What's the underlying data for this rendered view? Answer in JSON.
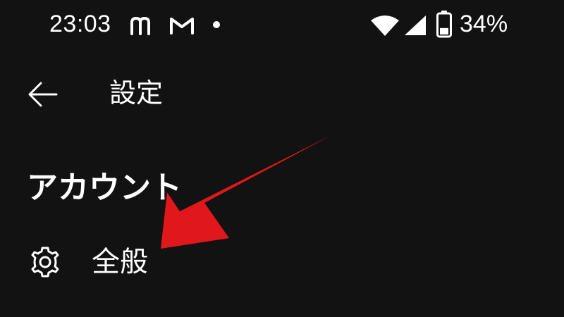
{
  "status_bar": {
    "time": "23:03",
    "battery_percent": "34%",
    "icons": [
      "m-app-icon",
      "gmail-icon",
      "notification-dot-icon",
      "wifi-icon",
      "cell-signal-icon",
      "battery-icon"
    ],
    "battery_level": 0.34
  },
  "app_bar": {
    "back_icon": "arrow-left-icon",
    "title": "設定"
  },
  "section": {
    "header": "アカウント"
  },
  "menu": {
    "items": [
      {
        "icon": "gear-icon",
        "label": "全般"
      }
    ]
  },
  "colors": {
    "background": "#121212",
    "text": "#ffffff",
    "annotation_arrow": "#e0181c"
  }
}
